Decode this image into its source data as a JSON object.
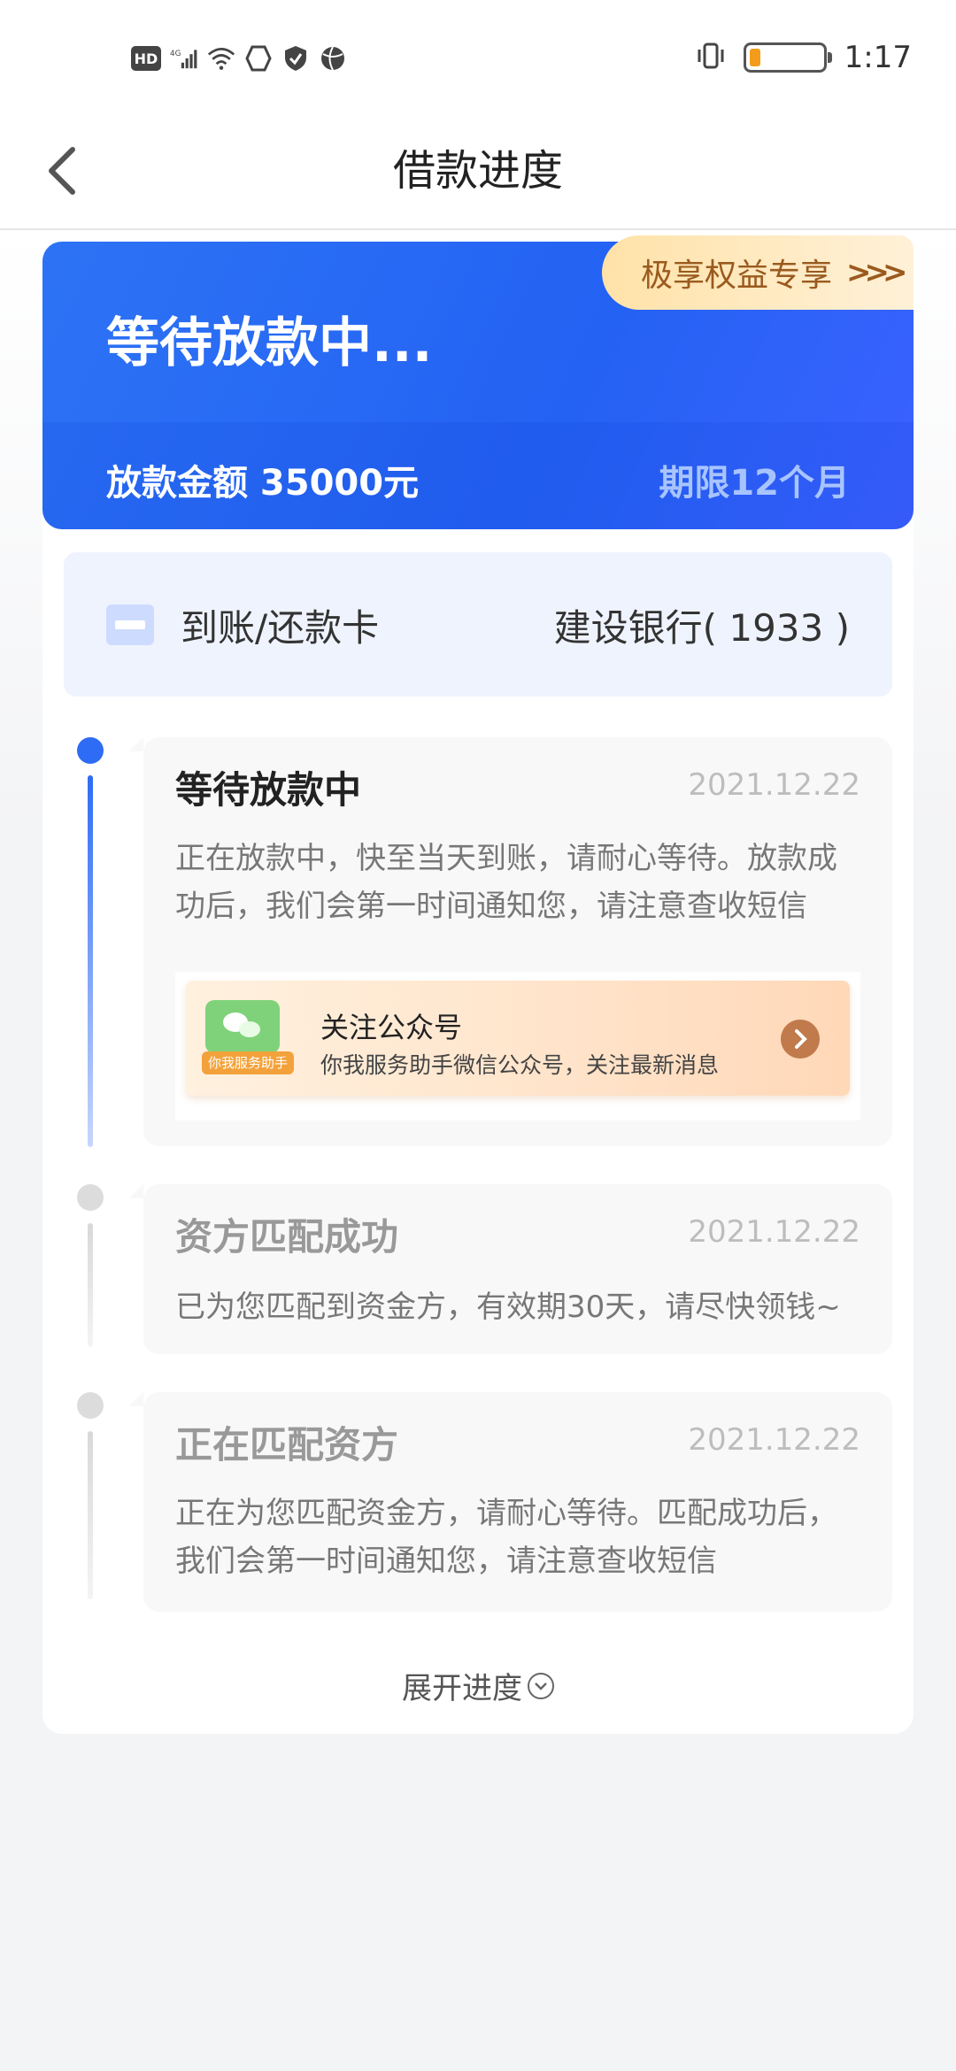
{
  "status_bar": {
    "hd": "HD",
    "network": "4G",
    "time": "1:17",
    "battery_level": 0.15,
    "battery_color": "#f39c1b"
  },
  "nav": {
    "title": "借款进度",
    "back_icon": "chevron-left-icon"
  },
  "hero": {
    "title": "等待放款中...",
    "amount": "放款金额 35000元",
    "term": "期限12个月",
    "perk_label": "极享权益专享",
    "perk_arrows": ">>>",
    "accent": "#2d73f5"
  },
  "bank": {
    "label": "到账/还款卡",
    "value": "建设银行( 1933 )"
  },
  "steps": [
    {
      "title": "等待放款中",
      "date": "2021.12.22",
      "desc": "正在放款中，快至当天到账，请耐心等待。放款成功后，我们会第一时间通知您，请注意查收短信",
      "active": true
    },
    {
      "title": "资方匹配成功",
      "date": "2021.12.22",
      "desc": "已为您匹配到资金方，有效期30天，请尽快领钱~",
      "active": false
    },
    {
      "title": "正在匹配资方",
      "date": "2021.12.22",
      "desc": "正在为您匹配资金方，请耐心等待。匹配成功后，我们会第一时间通知您，请注意查收短信",
      "active": false
    }
  ],
  "wechat_banner": {
    "title": "关注公众号",
    "subtitle": "你我服务助手微信公众号，关注最新消息",
    "tag": "你我服务助手"
  },
  "expand": {
    "label": "展开进度"
  }
}
